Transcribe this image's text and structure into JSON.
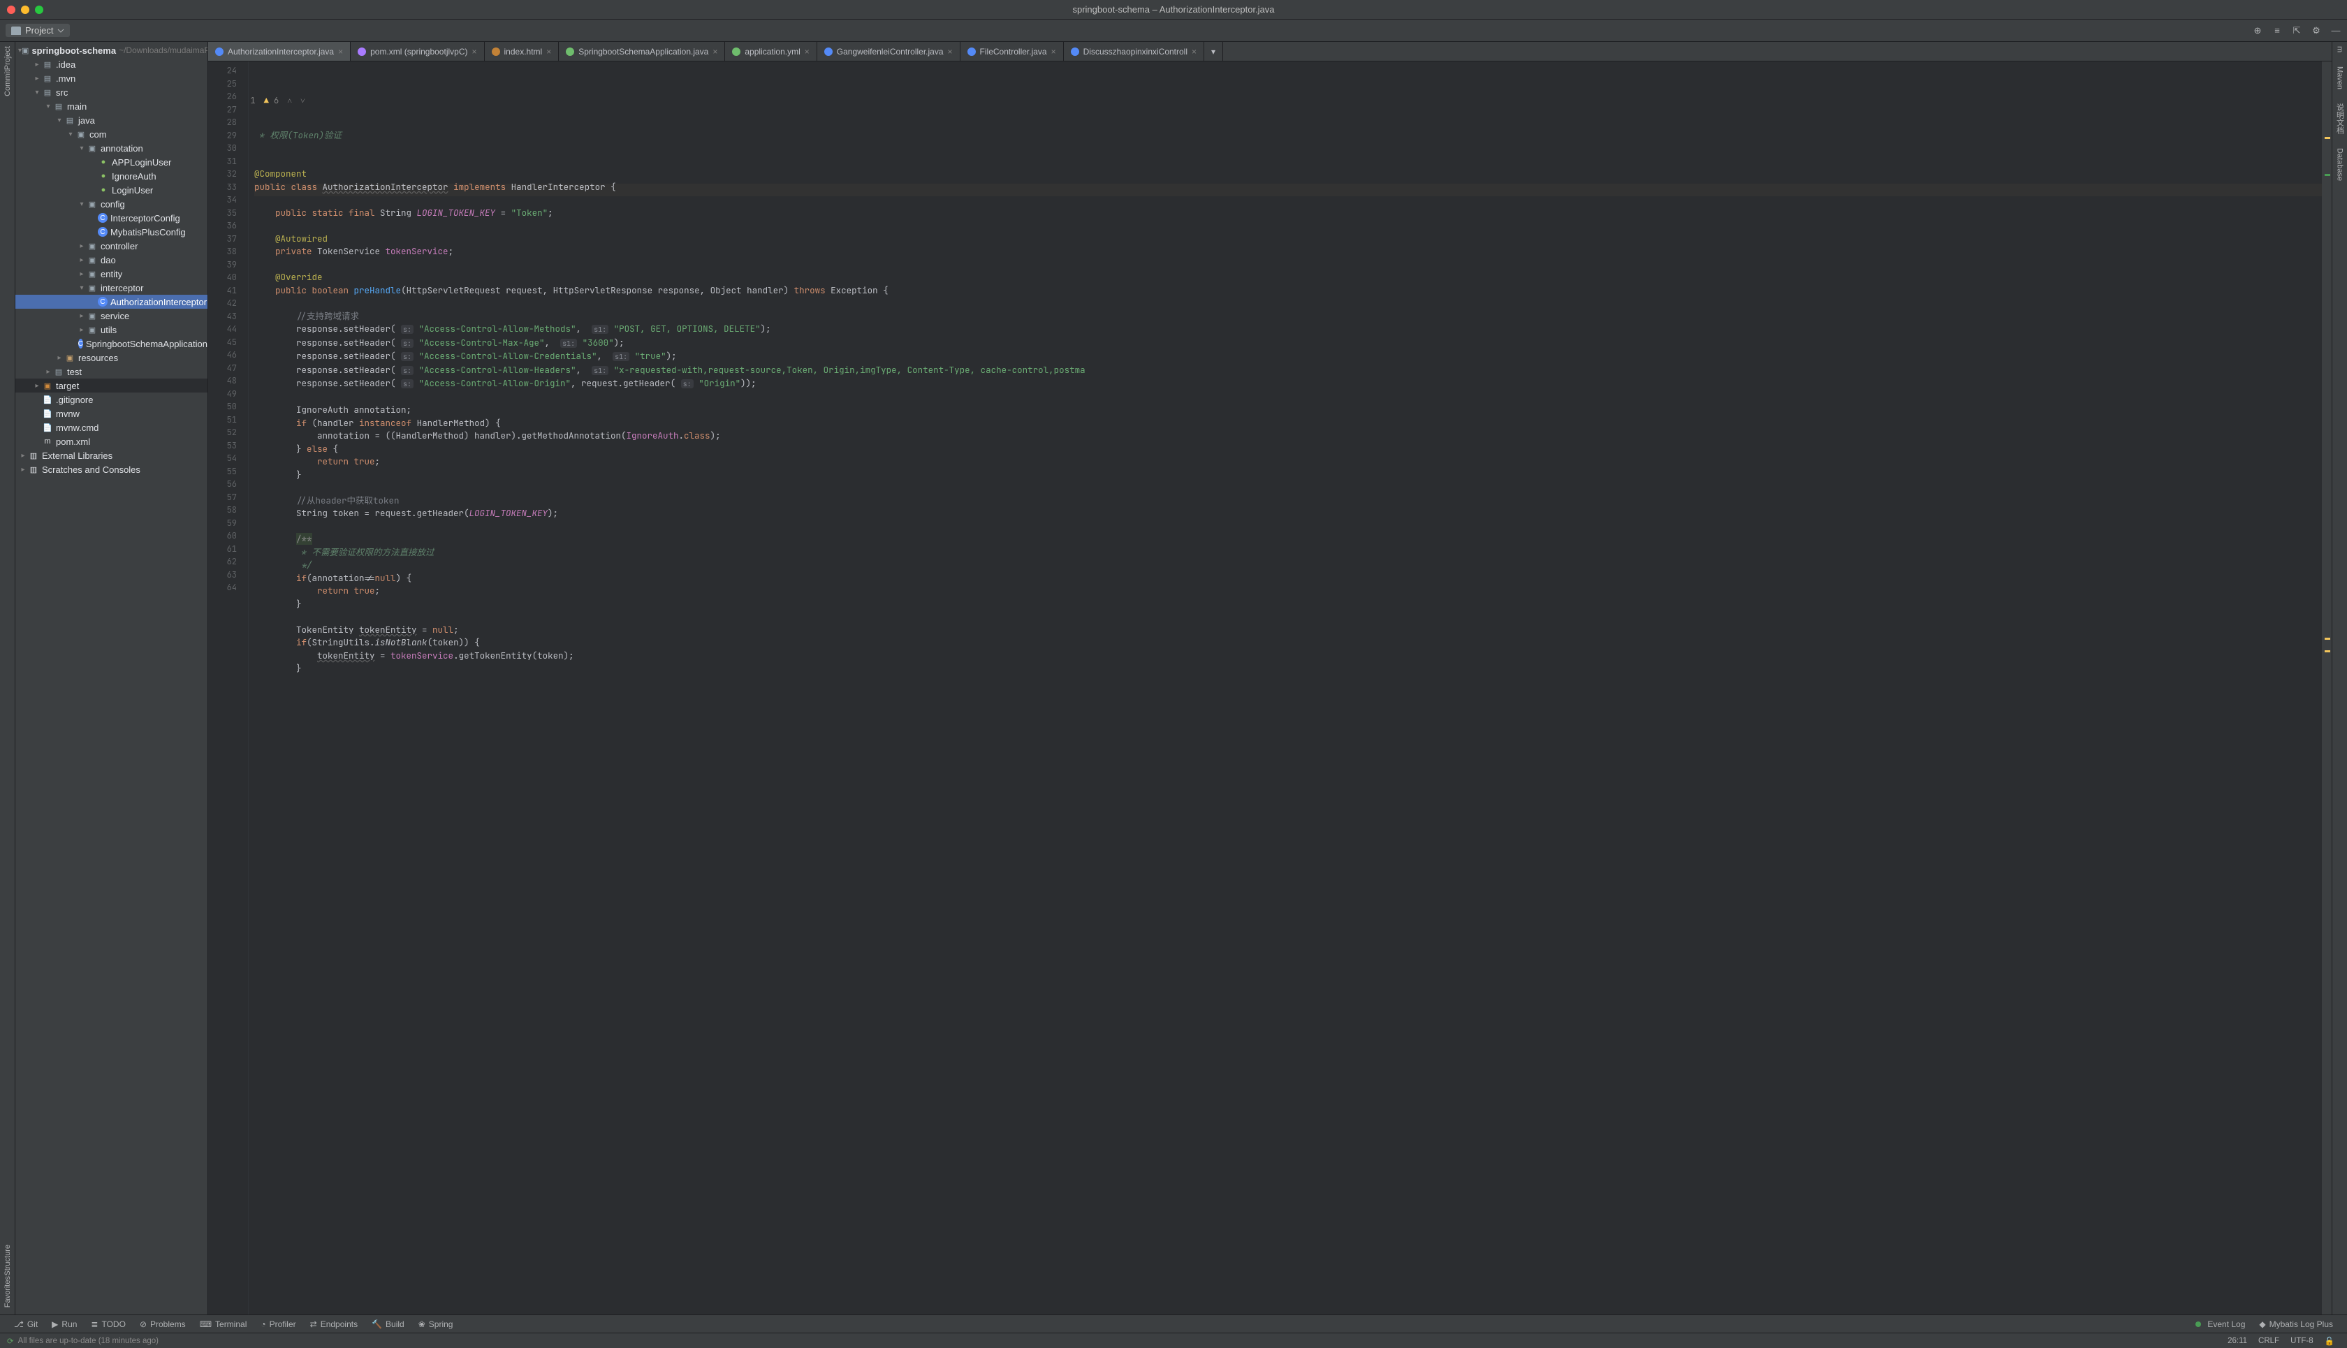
{
  "title": "springboot-schema – AuthorizationInterceptor.java",
  "sidebar": {
    "selector_label": "Project",
    "root": "springboot-schema",
    "root_path": "~/Downloads/mudaimaProj",
    "nodes": [
      {
        "depth": 1,
        "tw": "▸",
        "icon": "folder",
        "label": ".idea"
      },
      {
        "depth": 1,
        "tw": "▸",
        "icon": "folder",
        "label": ".mvn"
      },
      {
        "depth": 1,
        "tw": "▾",
        "icon": "folder",
        "label": "src"
      },
      {
        "depth": 2,
        "tw": "▾",
        "icon": "folder",
        "label": "main"
      },
      {
        "depth": 3,
        "tw": "▾",
        "icon": "folder",
        "label": "java"
      },
      {
        "depth": 4,
        "tw": "▾",
        "icon": "pkg",
        "label": "com"
      },
      {
        "depth": 5,
        "tw": "▾",
        "icon": "pkg",
        "label": "annotation"
      },
      {
        "depth": 6,
        "tw": "",
        "icon": "class",
        "label": "APPLoginUser"
      },
      {
        "depth": 6,
        "tw": "",
        "icon": "class",
        "label": "IgnoreAuth"
      },
      {
        "depth": 6,
        "tw": "",
        "icon": "class",
        "label": "LoginUser"
      },
      {
        "depth": 5,
        "tw": "▾",
        "icon": "pkg",
        "label": "config"
      },
      {
        "depth": 6,
        "tw": "",
        "icon": "classblue",
        "label": "InterceptorConfig"
      },
      {
        "depth": 6,
        "tw": "",
        "icon": "classblue",
        "label": "MybatisPlusConfig"
      },
      {
        "depth": 5,
        "tw": "▸",
        "icon": "pkg",
        "label": "controller"
      },
      {
        "depth": 5,
        "tw": "▸",
        "icon": "pkg",
        "label": "dao"
      },
      {
        "depth": 5,
        "tw": "▸",
        "icon": "pkg",
        "label": "entity"
      },
      {
        "depth": 5,
        "tw": "▾",
        "icon": "pkg",
        "label": "interceptor"
      },
      {
        "depth": 6,
        "tw": "",
        "icon": "classblue",
        "label": "AuthorizationInterceptor",
        "sel": true
      },
      {
        "depth": 5,
        "tw": "▸",
        "icon": "pkg",
        "label": "service"
      },
      {
        "depth": 5,
        "tw": "▸",
        "icon": "pkg",
        "label": "utils"
      },
      {
        "depth": 5,
        "tw": "",
        "icon": "classblue",
        "label": "SpringbootSchemaApplication"
      },
      {
        "depth": 3,
        "tw": "▸",
        "icon": "resources",
        "label": "resources"
      },
      {
        "depth": 2,
        "tw": "▸",
        "icon": "folder",
        "label": "test"
      },
      {
        "depth": 1,
        "tw": "▸",
        "icon": "target",
        "label": "target"
      },
      {
        "depth": 1,
        "tw": "",
        "icon": "file",
        "label": ".gitignore"
      },
      {
        "depth": 1,
        "tw": "",
        "icon": "file",
        "label": "mvnw"
      },
      {
        "depth": 1,
        "tw": "",
        "icon": "file",
        "label": "mvnw.cmd"
      },
      {
        "depth": 1,
        "tw": "",
        "icon": "pom",
        "label": "pom.xml"
      }
    ],
    "extra": [
      {
        "label": "External Libraries",
        "depth": 0,
        "tw": "▸",
        "icon": "lib"
      },
      {
        "label": "Scratches and Consoles",
        "depth": 0,
        "tw": "▸",
        "icon": "scratch"
      }
    ]
  },
  "tabs": [
    {
      "label": "AuthorizationInterceptor.java",
      "iconColor": "#548af7",
      "active": true
    },
    {
      "label": "pom.xml (springbootjlvpC)",
      "iconColor": "#a97bff"
    },
    {
      "label": "index.html",
      "iconColor": "#c28237"
    },
    {
      "label": "SpringbootSchemaApplication.java",
      "iconColor": "#6fbd6d"
    },
    {
      "label": "application.yml",
      "iconColor": "#6fbd6d"
    },
    {
      "label": "GangweifenleiController.java",
      "iconColor": "#548af7"
    },
    {
      "label": "FileController.java",
      "iconColor": "#548af7"
    },
    {
      "label": "DiscusszhaopinxinxiControll",
      "iconColor": "#548af7"
    }
  ],
  "inspections": {
    "warn1": "1",
    "warn2": "6"
  },
  "gutter_start": 24,
  "gutter_end": 64,
  "code_lines": [
    {
      "html": " <span class='doc'>* 权限(Token)验证</span>"
    },
    {
      "html": ""
    },
    {
      "html": "<span class='ann'>@Component</span>",
      "cursor": true
    },
    {
      "html": "<span class='kw'>public class</span> <span class='und'>AuthorizationInterceptor</span> <span class='kw'>implements</span> HandlerInterceptor {"
    },
    {
      "html": ""
    },
    {
      "html": "    <span class='kw'>public static final</span> String <span class='fld it'>LOGIN_TOKEN_KEY</span> = <span class='str'>\"Token\"</span>;"
    },
    {
      "html": ""
    },
    {
      "html": "    <span class='ann'>@Autowired</span>"
    },
    {
      "html": "    <span class='kw'>private</span> TokenService <span class='fld'>tokenService</span>;"
    },
    {
      "html": ""
    },
    {
      "html": "    <span class='ann'>@Override</span>"
    },
    {
      "html": "    <span class='kw'>public boolean</span> <span class='fn'>preHandle</span>(HttpServletRequest request, HttpServletResponse response, Object handler) <span class='kw'>throws</span> Exception {"
    },
    {
      "html": ""
    },
    {
      "html": "        <span class='cm'>//支持跨域请求</span>"
    },
    {
      "html": "        response.setHeader( <span class='hint'>s:</span> <span class='str'>\"Access-Control-Allow-Methods\"</span>,  <span class='hint'>s1:</span> <span class='str'>\"POST, GET, OPTIONS, DELETE\"</span>);"
    },
    {
      "html": "        response.setHeader( <span class='hint'>s:</span> <span class='str'>\"Access-Control-Max-Age\"</span>,  <span class='hint'>s1:</span> <span class='str'>\"3600\"</span>);"
    },
    {
      "html": "        response.setHeader( <span class='hint'>s:</span> <span class='str'>\"Access-Control-Allow-Credentials\"</span>,  <span class='hint'>s1:</span> <span class='str'>\"true\"</span>);"
    },
    {
      "html": "        response.setHeader( <span class='hint'>s:</span> <span class='str'>\"Access-Control-Allow-Headers\"</span>,  <span class='hint'>s1:</span> <span class='str'>\"x-requested-with,request-source,Token, Origin,imgType, Content-Type, cache-control,postma</span>"
    },
    {
      "html": "        response.setHeader( <span class='hint'>s:</span> <span class='str'>\"Access-Control-Allow-Origin\"</span>, request.getHeader( <span class='hint'>s:</span> <span class='str'>\"Origin\"</span>));"
    },
    {
      "html": ""
    },
    {
      "html": "        <span class='type'>IgnoreAuth</span> annotation;"
    },
    {
      "html": "        <span class='kw'>if</span> (handler <span class='kw'>instanceof</span> HandlerMethod) {"
    },
    {
      "html": "            annotation = ((HandlerMethod) handler).getMethodAnnotation(<span class='fld'>IgnoreAuth</span>.<span class='kw'>class</span>);"
    },
    {
      "html": "        } <span class='kw'>else</span> {"
    },
    {
      "html": "            <span class='kw'>return true</span>;"
    },
    {
      "html": "        }"
    },
    {
      "html": ""
    },
    {
      "html": "        <span class='cm'>//从header中获取token</span>"
    },
    {
      "html": "        String token = request.getHeader(<span class='fld it'>LOGIN_TOKEN_KEY</span>);"
    },
    {
      "html": ""
    },
    {
      "html": "        <span class='doc-bg'>/**</span>"
    },
    {
      "html": "<span class='doc'>         * 不需要验证权限的方法直接放过</span>"
    },
    {
      "html": "<span class='doc'>         */</span>"
    },
    {
      "html": "        <span class='kw'>if</span>(annotation!=<span class='kw'>null</span>) {"
    },
    {
      "html": "            <span class='kw'>return true</span>;"
    },
    {
      "html": "        }"
    },
    {
      "html": ""
    },
    {
      "html": "        TokenEntity <span class='und'>tokenEntity</span> = <span class='kw'>null</span>;"
    },
    {
      "html": "        <span class='kw'>if</span>(StringUtils.<span class='it'>isNotBlank</span>(token)) {"
    },
    {
      "html": "            <span class='und'>tokenEntity</span> = <span class='fld'>tokenService</span>.getTokenEntity(token);"
    },
    {
      "html": "        }"
    }
  ],
  "bottom": {
    "items_left": [
      "Git",
      "Run",
      "TODO",
      "Problems",
      "Terminal",
      "Profiler",
      "Endpoints",
      "Build",
      "Spring"
    ],
    "items_right": [
      "Event Log",
      "Mybatis Log Plus"
    ]
  },
  "status": {
    "left": "All files are up-to-date (18 minutes ago)",
    "pos": "26:11",
    "sep": "CRLF",
    "enc": "UTF-8"
  },
  "left_rail": [
    "Project",
    "Commit"
  ],
  "left_rail_bottom": [
    "Structure",
    "Favorites"
  ],
  "right_rail": [
    "m",
    "Maven",
    "说明文档",
    "Database"
  ]
}
